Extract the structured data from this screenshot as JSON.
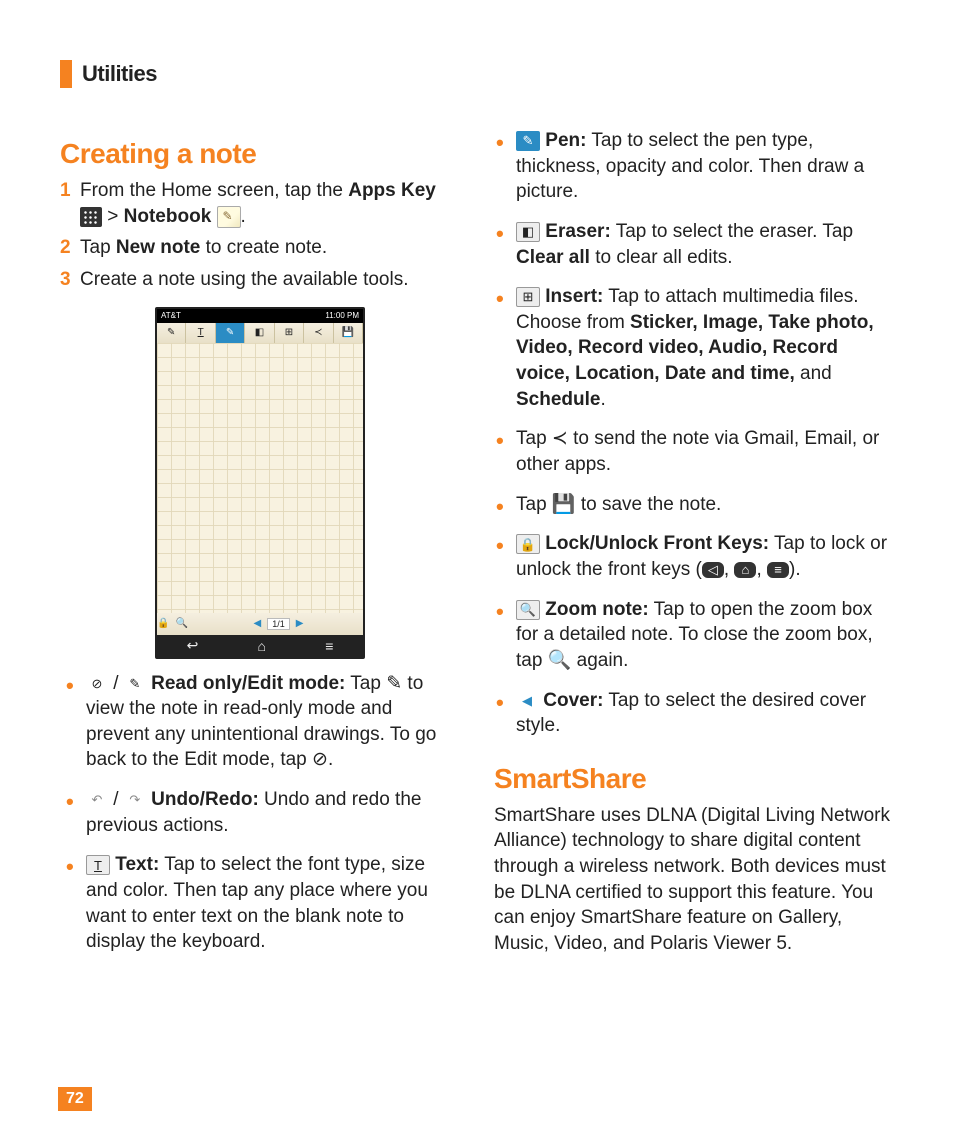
{
  "header": {
    "title": "Utilities"
  },
  "page_number": "72",
  "section1": {
    "title": "Creating a note",
    "steps": [
      {
        "n": "1",
        "pre": "From the Home screen, tap the ",
        "b1": "Apps Key",
        "mid": " > ",
        "b2": "Notebook",
        "post": "."
      },
      {
        "n": "2",
        "pre": "Tap ",
        "b1": "New note",
        "post": " to create note."
      },
      {
        "n": "3",
        "pre": "Create a note using the available tools."
      }
    ]
  },
  "phone": {
    "carrier": "AT&T",
    "time": "11:00 PM",
    "pager": "1/1"
  },
  "left_bullets": [
    {
      "icons": "⊘ / ✎",
      "label": "Read only/Edit mode:",
      "text": " Tap ✎ to view the note in read-only mode and prevent any unintentional drawings. To go back to the Edit mode, tap ⊘."
    },
    {
      "icons": "↶ / ↷",
      "label": "Undo/Redo:",
      "text": " Undo and redo the previous actions."
    },
    {
      "icons": "T",
      "label": "Text:",
      "text": " Tap to select the font type, size and color. Then tap any place where you want to enter text on the blank note to display the keyboard."
    }
  ],
  "right_bullets": [
    {
      "icon": "pen",
      "label": "Pen:",
      "text": " Tap to select the pen type, thickness, opacity and color. Then draw a picture."
    },
    {
      "icon": "eraser",
      "label": "Eraser:",
      "text_pre": " Tap to select the eraser. Tap ",
      "bold_in": "Clear all",
      "text_post": " to clear all edits."
    },
    {
      "icon": "insert",
      "label": "Insert:",
      "text_pre": " Tap to attach multimedia files. Choose from ",
      "bold_in": "Sticker, Image, Take photo, Video, Record video, Audio, Record voice, Location, Date and time,",
      "text_post": " and ",
      "bold_in2": "Schedule",
      "text_end": "."
    },
    {
      "icon": "share",
      "text": "Tap ≺ to send the note via Gmail, Email, or other apps."
    },
    {
      "icon": "save",
      "text": "Tap 💾 to save the note."
    },
    {
      "icon": "lock",
      "label": "Lock/Unlock Front Keys:",
      "text": " Tap to lock or unlock the front keys (◁, ⌂, ≡)."
    },
    {
      "icon": "zoom",
      "label": "Zoom note:",
      "text": " Tap to open the zoom box for a detailed note. To close the zoom box, tap 🔍 again."
    },
    {
      "icon": "cover",
      "label": "Cover:",
      "text": " Tap to select the desired cover style."
    }
  ],
  "section2": {
    "title": "SmartShare",
    "para": "SmartShare uses DLNA (Digital Living Network Alliance) technology to share digital content through a wireless network. Both devices must be DLNA certified to support this feature. You can enjoy SmartShare feature on Gallery, Music, Video, and Polaris Viewer 5."
  }
}
